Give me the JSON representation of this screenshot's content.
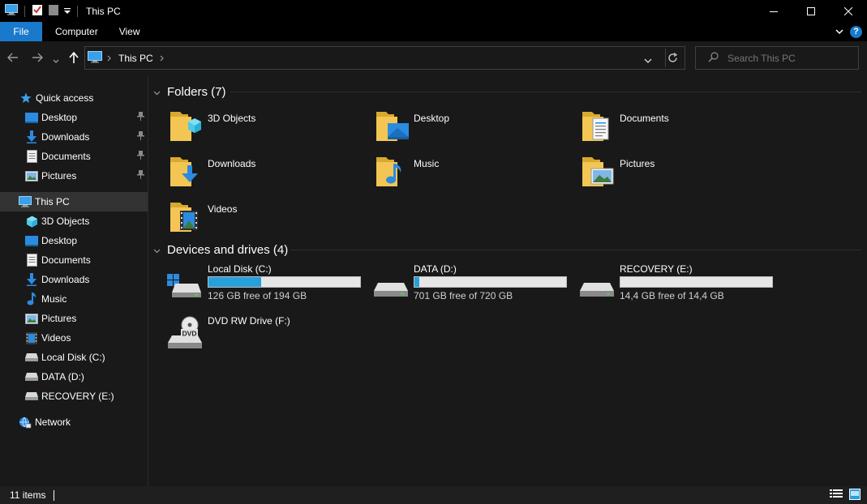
{
  "window": {
    "title": "This PC"
  },
  "ribbon": {
    "tabs": [
      "File",
      "Computer",
      "View"
    ],
    "help": "?"
  },
  "address": {
    "location": "This PC",
    "search_placeholder": "Search This PC"
  },
  "sidebar": {
    "quick_access": {
      "label": "Quick access",
      "items": [
        {
          "label": "Desktop",
          "icon": "desktop-icon",
          "pinned": true
        },
        {
          "label": "Downloads",
          "icon": "downloads-icon",
          "pinned": true
        },
        {
          "label": "Documents",
          "icon": "documents-icon",
          "pinned": true
        },
        {
          "label": "Pictures",
          "icon": "pictures-icon",
          "pinned": true
        }
      ]
    },
    "this_pc": {
      "label": "This PC",
      "items": [
        {
          "label": "3D Objects",
          "icon": "3d-objects-icon"
        },
        {
          "label": "Desktop",
          "icon": "desktop-icon"
        },
        {
          "label": "Documents",
          "icon": "documents-icon"
        },
        {
          "label": "Downloads",
          "icon": "downloads-icon"
        },
        {
          "label": "Music",
          "icon": "music-icon"
        },
        {
          "label": "Pictures",
          "icon": "pictures-icon"
        },
        {
          "label": "Videos",
          "icon": "videos-icon"
        },
        {
          "label": "Local Disk (C:)",
          "icon": "drive-icon"
        },
        {
          "label": "DATA (D:)",
          "icon": "drive-icon"
        },
        {
          "label": "RECOVERY (E:)",
          "icon": "drive-icon"
        }
      ]
    },
    "network": {
      "label": "Network"
    }
  },
  "folders": {
    "header": "Folders (7)",
    "items": [
      {
        "label": "3D Objects",
        "icon": "3d-objects-folder-icon"
      },
      {
        "label": "Desktop",
        "icon": "desktop-folder-icon"
      },
      {
        "label": "Documents",
        "icon": "documents-folder-icon"
      },
      {
        "label": "Downloads",
        "icon": "downloads-folder-icon"
      },
      {
        "label": "Music",
        "icon": "music-folder-icon"
      },
      {
        "label": "Pictures",
        "icon": "pictures-folder-icon"
      },
      {
        "label": "Videos",
        "icon": "videos-folder-icon"
      }
    ]
  },
  "drives": {
    "header": "Devices and drives (4)",
    "items": [
      {
        "label": "Local Disk (C:)",
        "free": "126 GB free of 194 GB",
        "used_fraction": 0.35
      },
      {
        "label": "DATA (D:)",
        "free": "701 GB free of 720 GB",
        "used_fraction": 0.03
      },
      {
        "label": "RECOVERY (E:)",
        "free": "14,4 GB free of 14,4 GB",
        "used_fraction": 0.0
      },
      {
        "label": "DVD RW Drive (F:)",
        "disc_label": "DVD"
      }
    ]
  },
  "status": {
    "item_count": "11 items"
  },
  "colors": {
    "accent": "#1979ca",
    "drive_fill": "#26a0da",
    "folder": "#f3c654"
  }
}
